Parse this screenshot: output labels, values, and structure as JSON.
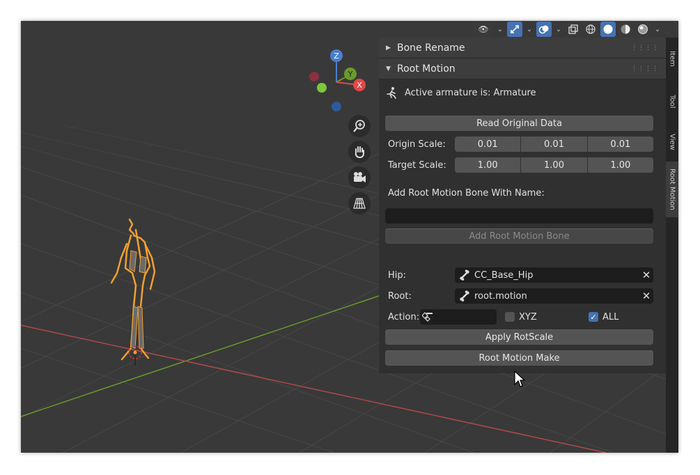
{
  "header": {
    "buttons": [
      {
        "name": "visibility-icon",
        "active": false
      },
      {
        "name": "gizmo-icon",
        "active": true
      },
      {
        "name": "overlay-icon",
        "active": true
      },
      {
        "name": "xray-icon",
        "active": false
      },
      {
        "name": "wireframe-shading-icon",
        "active": false
      },
      {
        "name": "solid-shading-icon",
        "active": true
      },
      {
        "name": "material-shading-icon",
        "active": false
      },
      {
        "name": "rendered-shading-icon",
        "active": false
      }
    ]
  },
  "gizmo": {
    "z": "Z",
    "y": "Y",
    "x": "X"
  },
  "colors": {
    "accent": "#4772b3",
    "armature": "#f0a030",
    "x_axis": "#c83c3c",
    "y_axis": "#6a9a2a"
  },
  "panels": {
    "bone_rename": {
      "title": "Bone Rename"
    },
    "root_motion": {
      "title": "Root Motion",
      "active_armature": "Active armature is: Armature",
      "read_button": "Read Original Data",
      "origin_scale_label": "Origin Scale:",
      "origin_scale": [
        "0.01",
        "0.01",
        "0.01"
      ],
      "target_scale_label": "Target Scale:",
      "target_scale": [
        "1.00",
        "1.00",
        "1.00"
      ],
      "add_bone_label": "Add Root Motion Bone With Name:",
      "bone_name_value": "",
      "add_bone_button": "Add Root Motion Bone",
      "hip_label": "Hip:",
      "hip_value": "CC_Base_Hip",
      "root_label": "Root:",
      "root_value": "root.motion",
      "action_label": "Action:",
      "xyz_label": "XYZ",
      "xyz_checked": false,
      "all_label": "ALL",
      "all_checked": true,
      "apply_button": "Apply RotScale",
      "make_button": "Root Motion Make"
    }
  },
  "sidetabs": [
    "Item",
    "Tool",
    "View",
    "Root Motion"
  ]
}
